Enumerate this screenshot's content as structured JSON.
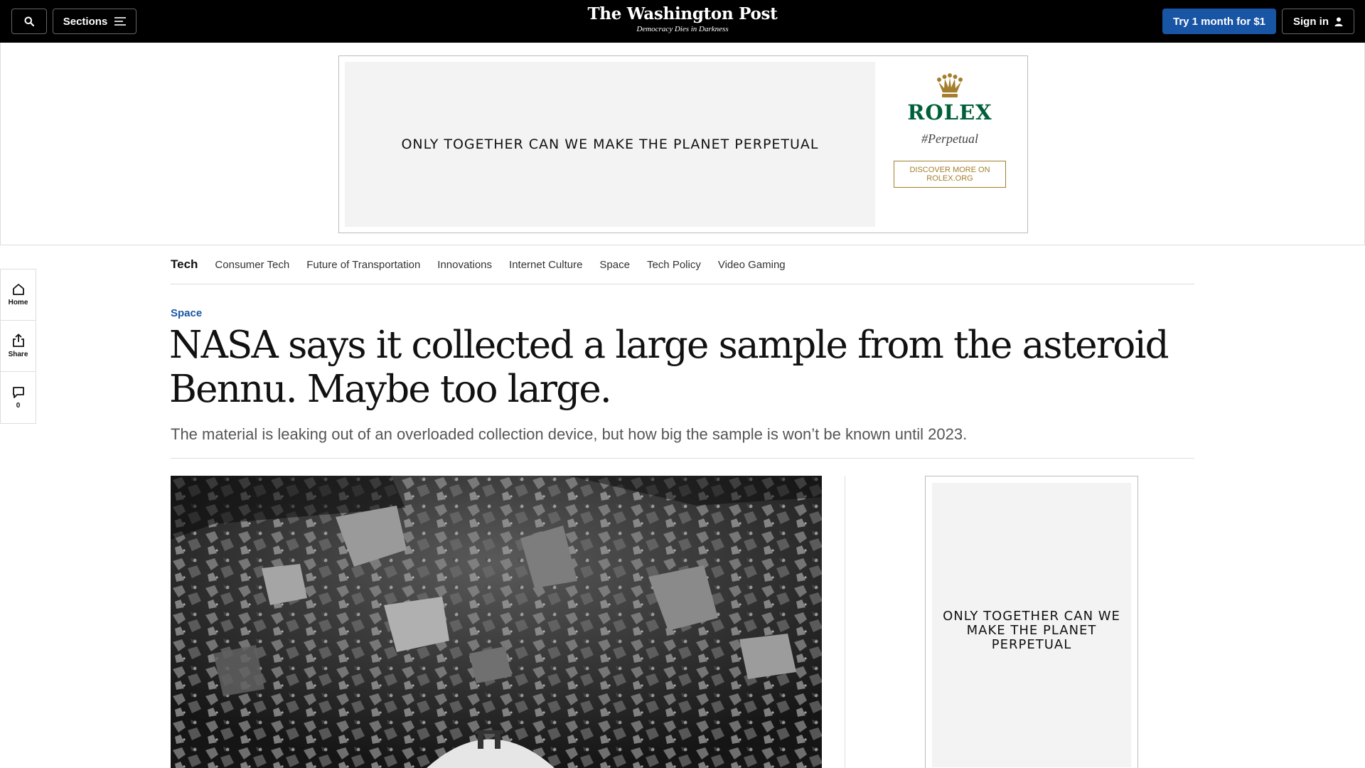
{
  "header": {
    "sections_label": "Sections",
    "masthead_title": "The Washington Post",
    "masthead_tagline": "Democracy Dies in Darkness",
    "subscribe_label": "Try 1 month for $1",
    "signin_label": "Sign in"
  },
  "top_ad": {
    "headline": "ONLY TOGETHER CAN WE MAKE THE PLANET PERPETUAL",
    "brand": "ROLEX",
    "tagline": "#Perpetual",
    "cta": "DISCOVER MORE ON ROLEX.ORG",
    "brand_color": "#006039",
    "cta_color": "#a37e2c"
  },
  "section_nav": {
    "home": "Tech",
    "items": [
      "Consumer Tech",
      "Future of Transportation",
      "Innovations",
      "Internet Culture",
      "Space",
      "Tech Policy",
      "Video Gaming"
    ]
  },
  "left_rail": {
    "home_label": "Home",
    "share_label": "Share",
    "comments_count": "0"
  },
  "article": {
    "kicker": "Space",
    "headline": "NASA says it collected a large sample from the asteroid Bennu. Maybe too large.",
    "subheadline": "The material is leaking out of an overloaded collection device, but how big the sample is won’t be known until 2023."
  },
  "side_ad": {
    "text": "ONLY TOGETHER CAN WE MAKE THE PLANET PERPETUAL"
  },
  "colors": {
    "accent": "#1955a5",
    "topbar": "#000000"
  }
}
